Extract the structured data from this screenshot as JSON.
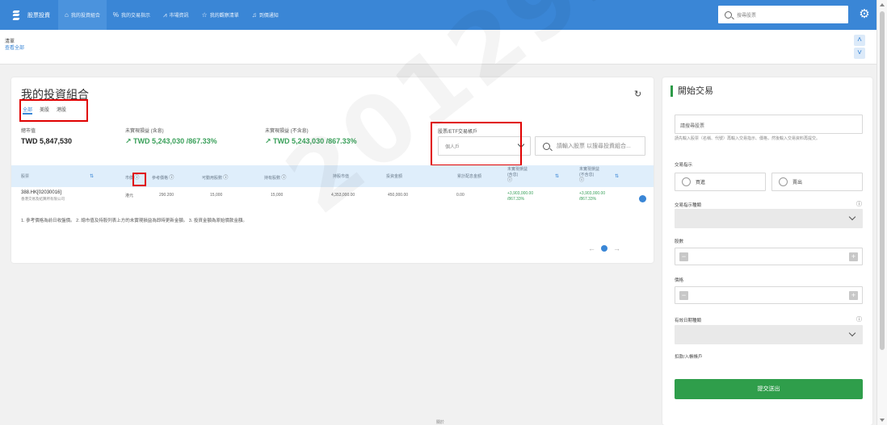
{
  "header": {
    "brand": "股票投資",
    "nav": [
      {
        "label": "我的投資組合",
        "icon": "home-icon",
        "active": true
      },
      {
        "label": "我的交易指示",
        "icon": "percent-icon",
        "active": false
      },
      {
        "label": "市場資訊",
        "icon": "chart-icon",
        "active": false
      },
      {
        "label": "我的觀察清單",
        "icon": "star-icon",
        "active": false
      },
      {
        "label": "到價通知",
        "icon": "bell-icon",
        "active": false
      }
    ],
    "search_placeholder": "搜尋股票"
  },
  "watchlist": {
    "title": "清單",
    "link": "查看全部"
  },
  "portfolio": {
    "title": "我的投資組合",
    "tabs": [
      "全部",
      "美股",
      "港股"
    ],
    "market_value_label": "總市值",
    "market_value": "TWD 5,847,530",
    "unrealized_incl_label": "未實現損益 (含息)",
    "unrealized_incl": "TWD 5,243,030 /867.33%",
    "unrealized_excl_label": "未實現損益 (不含息)",
    "unrealized_excl": "TWD 5,243,030 /867.33%",
    "account_label": "股票/ETF交易帳戶",
    "account_value": "個人戶",
    "search_placeholder": "請輸入股票 以搜尋投資組合...",
    "columns": {
      "stock": "股票",
      "price": "市價",
      "avg_cost": "參考價格",
      "available": "可動用股數",
      "holding": "持有股數",
      "market_value": "持股市值",
      "investment": "投資金額",
      "dividend": "累計配息金額",
      "pnl_incl": "未實現損益(含息)",
      "pnl_excl": "未實現損益(不含息)"
    },
    "row": {
      "name": "388.HK[02030016]",
      "sub": "香港交易及結算所有限公司",
      "price": "港元",
      "avg_cost": "290.200",
      "available": "15,000",
      "holding": "15,000",
      "market_value": "4,353,000.00",
      "investment": "450,000.00",
      "dividend": "0.00",
      "pnl_incl_amount": "+3,903,000.00",
      "pnl_incl_pct": "/867.33%",
      "pnl_excl_amount": "+3,903,000.00",
      "pnl_excl_pct": "/867.33%"
    },
    "notes": "1. 參考價格為前日收盤價。 2. 總市值及持股列表上方的未實現損益為即時更新金額。 3. 投資金額為原始價款金額。",
    "page": "1"
  },
  "watermark": "2012937",
  "trade": {
    "title": "開始交易",
    "stock_placeholder": "請搜尋股票",
    "hint": "請先輸入股票（名稱、代號）再輸入交易指示、價格，然後輸入交易資料再提交。",
    "direction_label": "交易指示",
    "buy": "買進",
    "sell": "賣出",
    "order_type_label": "交易指示種類",
    "shares_label": "股數",
    "price_label": "價格",
    "validity_label": "有效日期種類",
    "account_label": "扣款/入帳帳戶",
    "submit": "提交送出"
  },
  "footer_mark": "關於"
}
